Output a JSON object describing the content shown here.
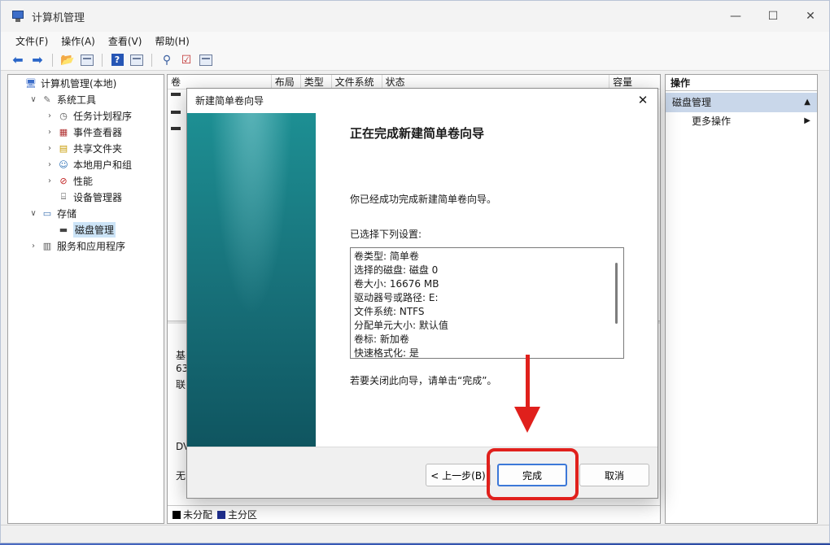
{
  "window": {
    "title": "计算机管理"
  },
  "menu": [
    "文件(F)",
    "操作(A)",
    "查看(V)",
    "帮助(H)"
  ],
  "tree": [
    {
      "label": "计算机管理(本地)",
      "depth": 0,
      "expander": "",
      "icon": "computer-icon"
    },
    {
      "label": "系统工具",
      "depth": 1,
      "expander": "∨",
      "icon": "tools-icon"
    },
    {
      "label": "任务计划程序",
      "depth": 2,
      "expander": "›",
      "icon": "clock-icon"
    },
    {
      "label": "事件查看器",
      "depth": 2,
      "expander": "›",
      "icon": "event-log-icon"
    },
    {
      "label": "共享文件夹",
      "depth": 2,
      "expander": "›",
      "icon": "shared-folder-icon"
    },
    {
      "label": "本地用户和组",
      "depth": 2,
      "expander": "›",
      "icon": "users-icon"
    },
    {
      "label": "性能",
      "depth": 2,
      "expander": "›",
      "icon": "performance-icon"
    },
    {
      "label": "设备管理器",
      "depth": 2,
      "expander": "",
      "icon": "device-manager-icon"
    },
    {
      "label": "存储",
      "depth": 1,
      "expander": "∨",
      "icon": "storage-icon"
    },
    {
      "label": "磁盘管理",
      "depth": 2,
      "expander": "",
      "icon": "disk-icon",
      "selected": true
    },
    {
      "label": "服务和应用程序",
      "depth": 1,
      "expander": "›",
      "icon": "services-icon"
    }
  ],
  "columns": [
    {
      "label": "卷"
    },
    {
      "label": "布局"
    },
    {
      "label": "类型"
    },
    {
      "label": "文件系统"
    },
    {
      "label": "状态"
    },
    {
      "label": "容量"
    }
  ],
  "background_fragments": [
    "基",
    "63",
    "联",
    "DV",
    "无"
  ],
  "legend": [
    {
      "label": "未分配",
      "color": "#000000"
    },
    {
      "label": "主分区",
      "color": "#1f2f8f"
    }
  ],
  "actions": {
    "header": "操作",
    "section": "磁盘管理",
    "more": "更多操作"
  },
  "dialog": {
    "title": "新建简单卷向导",
    "heading": "正在完成新建简单卷向导",
    "message": "你已经成功完成新建简单卷向导。",
    "settings_label": "已选择下列设置:",
    "settings": [
      "卷类型: 简单卷",
      "选择的磁盘: 磁盘 0",
      "卷大小: 16676 MB",
      "驱动器号或路径: E:",
      "文件系统: NTFS",
      "分配单元大小: 默认值",
      "卷标: 新加卷",
      "快速格式化: 是"
    ],
    "close_hint": "若要关闭此向导，请单击“完成”。",
    "back_label": "< 上一步(B)",
    "finish_label": "完成",
    "cancel_label": "取消"
  },
  "colors": {
    "annotation": "#e0201c",
    "banner": "#176f78",
    "selection": "#cce4f7",
    "action_section": "#c9d7ea"
  }
}
